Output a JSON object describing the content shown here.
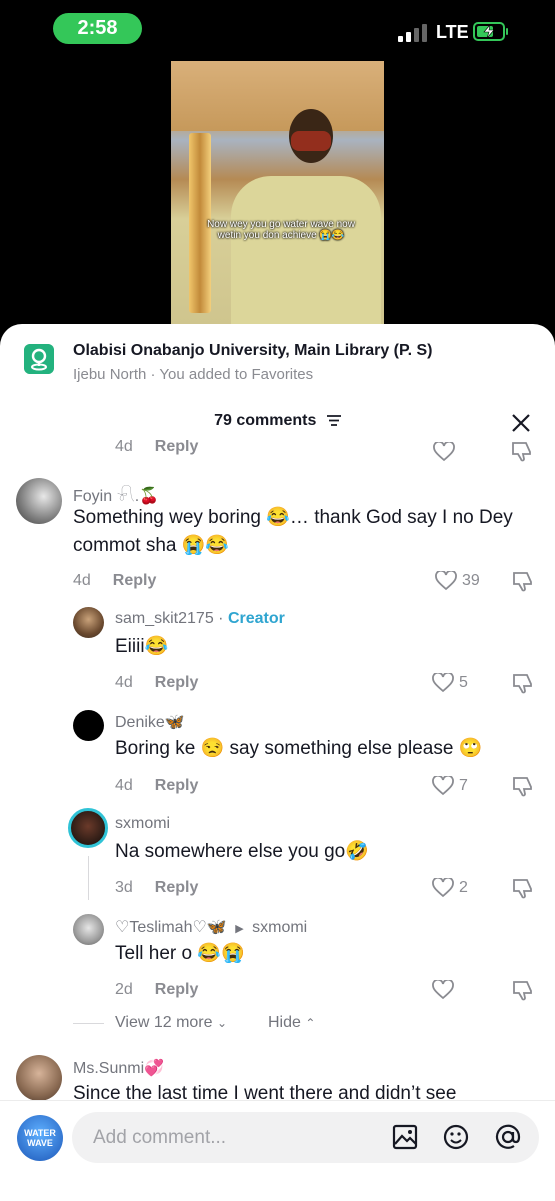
{
  "status_bar": {
    "time": "2:58",
    "network": "LTE"
  },
  "video": {
    "caption": "Now wey you go water wave now wetin you don achieve 😭😂"
  },
  "location": {
    "title": "Olabisi Onabanjo University, Main Library (P. S)",
    "subtitle": "Ijebu North · You added to Favorites",
    "icon": "map-pin-icon"
  },
  "comments_header": {
    "count_label": "79 comments",
    "filter_icon": "menu-icon",
    "close_icon": "close-icon"
  },
  "prev_comment": {
    "age": "4d",
    "reply": "Reply"
  },
  "comments": [
    {
      "username": "Foyin 𓍯.🍒",
      "text": "Something wey boring 😂… thank God say I no Dey commot sha 😭😂",
      "age": "4d",
      "reply": "Reply",
      "likes": "39"
    },
    {
      "username": "sam_skit2175",
      "creator_label": "Creator",
      "text": "Eiiii😂",
      "age": "4d",
      "reply": "Reply",
      "likes": "5"
    },
    {
      "username": "Denike🦋",
      "text": "Boring ke 😒 say something else please 🙄",
      "age": "4d",
      "reply": "Reply",
      "likes": "7"
    },
    {
      "username": "sxmomi",
      "text": "Na somewhere else you go🤣",
      "age": "3d",
      "reply": "Reply",
      "likes": "2"
    },
    {
      "username": "♡Teslimah♡🦋",
      "reply_to": "sxmomi",
      "text": "Tell her o 😂😭",
      "age": "2d",
      "reply": "Reply",
      "likes": ""
    }
  ],
  "thread_controls": {
    "view_more": "View 12 more",
    "hide": "Hide"
  },
  "next_comment": {
    "username": "Ms.Sunmi💞",
    "text": "Since the last time I went there and didn’t see"
  },
  "composer": {
    "placeholder": "Add comment...",
    "avatar_label": "WATER WAVE",
    "icons": [
      "image-icon",
      "emoji-icon",
      "mention-icon"
    ]
  },
  "colors": {
    "accent_green": "#34c759",
    "creator_blue": "#2fa5d0",
    "location_green": "#23b27e"
  }
}
